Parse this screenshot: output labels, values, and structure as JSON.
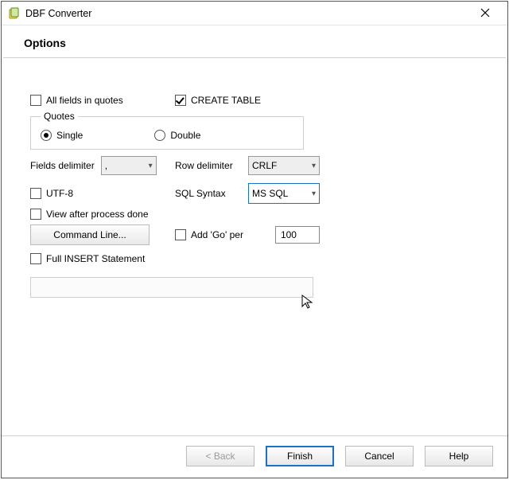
{
  "window": {
    "title": "DBF Converter"
  },
  "header": {
    "options": "Options"
  },
  "opts": {
    "all_fields_in_quotes": "All fields in quotes",
    "create_table": "CREATE TABLE",
    "quotes_legend": "Quotes",
    "single": "Single",
    "double": "Double",
    "fields_delimiter": "Fields delimiter",
    "fields_delimiter_value": ",",
    "row_delimiter": "Row delimiter",
    "row_delimiter_value": "CRLF",
    "utf8": "UTF-8",
    "sql_syntax": "SQL Syntax",
    "sql_syntax_value": "MS SQL",
    "view_after": "View after process done",
    "command_line": "Command Line...",
    "add_go_per": "Add 'Go' per",
    "add_go_value": "100",
    "full_insert": "Full INSERT Statement"
  },
  "footer": {
    "back": "< Back",
    "finish": "Finish",
    "cancel": "Cancel",
    "help": "Help"
  }
}
